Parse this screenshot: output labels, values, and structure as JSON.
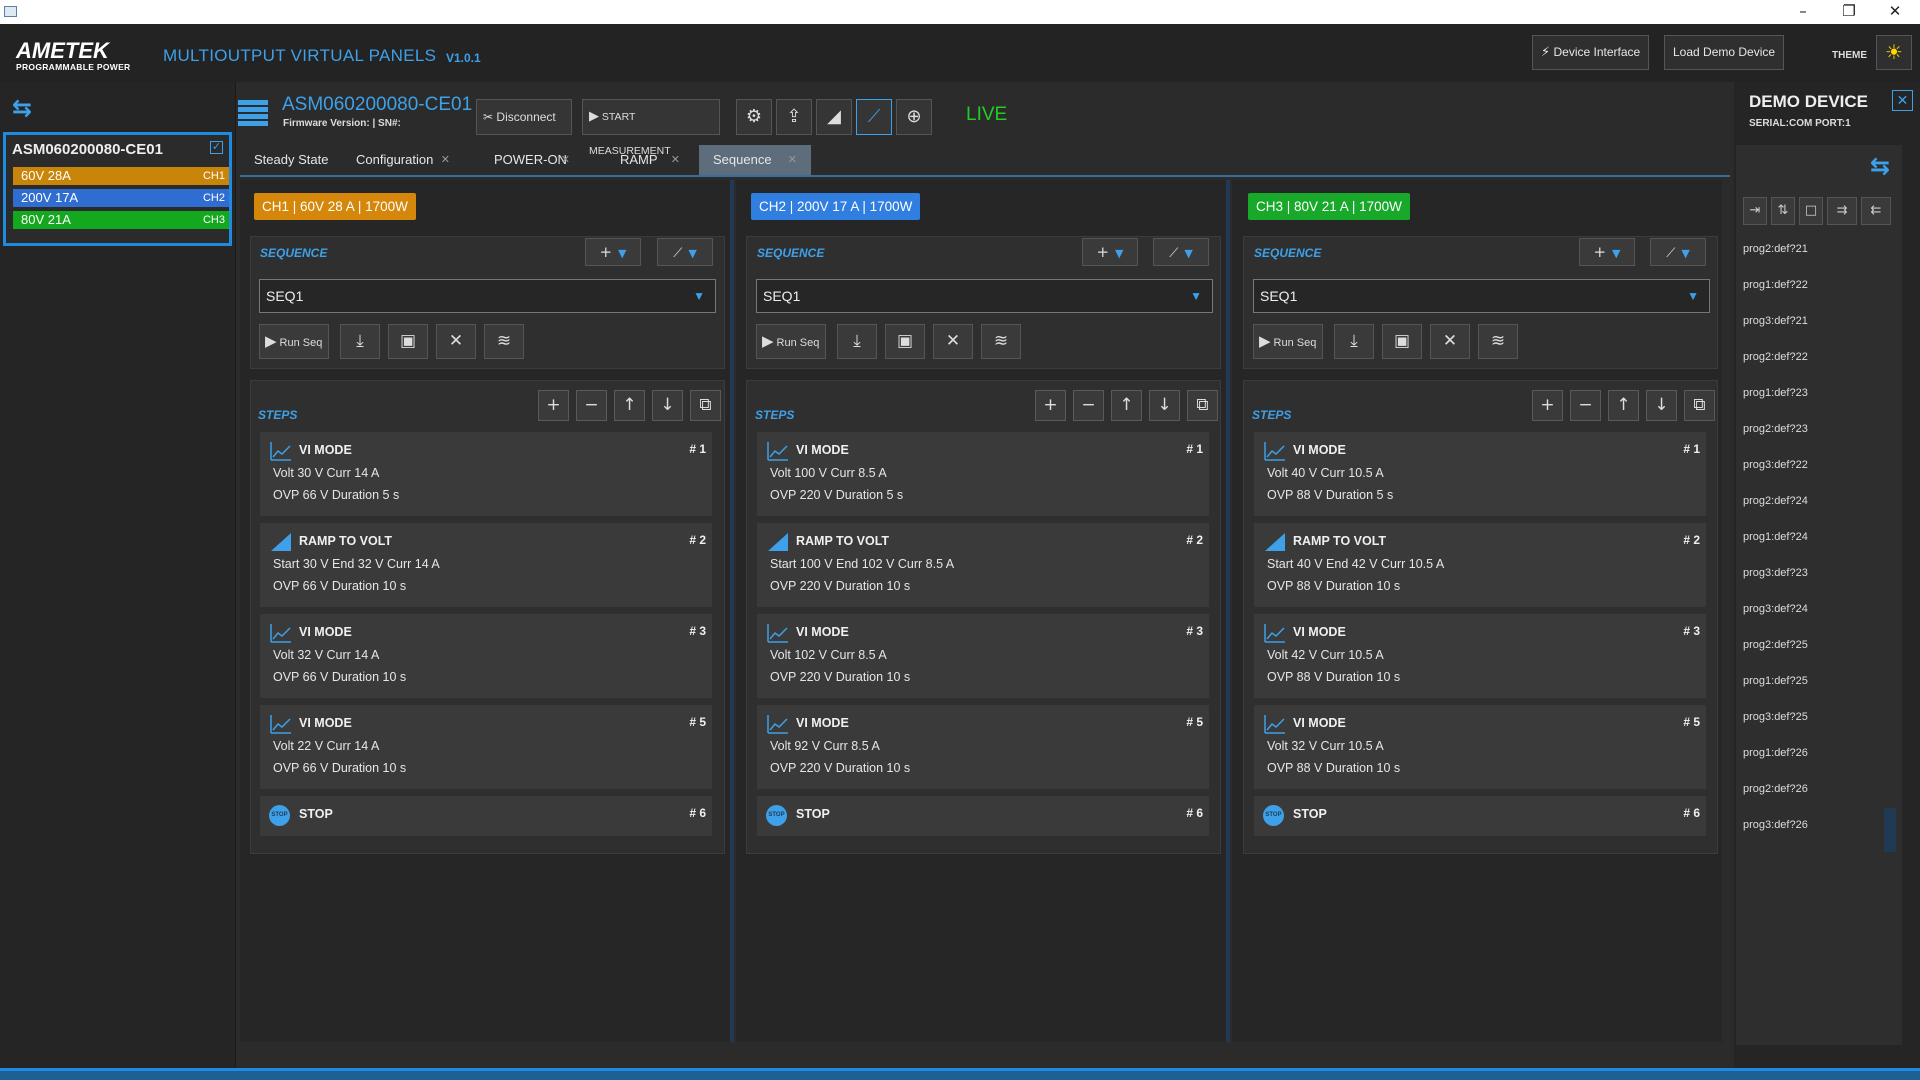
{
  "titlebar": {
    "minimize": "–",
    "restore": "❐",
    "close": "✕"
  },
  "header": {
    "logo_main": "AMETEK",
    "logo_sub": "PROGRAMMABLE POWER",
    "app_title": "MULTIOUTPUT VIRTUAL PANELS",
    "version": "V1.0.1",
    "device_interface": "Device Interface",
    "load_demo": "Load Demo Device",
    "theme_label": "THEME",
    "theme_icon": "sun-icon"
  },
  "sidebar": {
    "device_name": "ASM060200080-CE01",
    "channels": [
      {
        "label": "60V 28A",
        "tag": "CH1",
        "color": "#c8850a"
      },
      {
        "label": "200V 17A",
        "tag": "CH2",
        "color": "#2f6ed0"
      },
      {
        "label": "80V 21A",
        "tag": "CH3",
        "color": "#14a81e"
      }
    ]
  },
  "device": {
    "name": "ASM060200080-CE01",
    "firmware": "Firmware Version:  |  SN#:",
    "disconnect": "Disconnect",
    "start_measurement": "START MEASUREMENT",
    "status": "LIVE",
    "tool_icons": [
      "gear-icon",
      "export-icon",
      "ramp-icon",
      "chart-icon",
      "target-icon"
    ]
  },
  "tabs": [
    {
      "label": "Steady State",
      "closable": false
    },
    {
      "label": "Configuration",
      "closable": true
    },
    {
      "label": "POWER-ON",
      "closable": true
    },
    {
      "label": "RAMP",
      "closable": true
    },
    {
      "label": "Sequence",
      "closable": true,
      "active": true
    }
  ],
  "channels": [
    {
      "badge": "CH1 | 60V 28 A | 1700W",
      "color": "#d4870a",
      "sequence_label": "SEQUENCE",
      "selected_sequence": "SEQ1",
      "run_label": "Run Seq",
      "steps_label": "STEPS",
      "steps": [
        {
          "type": "VI MODE",
          "num": "# 1",
          "l1": "Volt 30 V   Curr 14 A",
          "l2": "OVP  66 V   Duration  5 s"
        },
        {
          "type": "RAMP TO VOLT",
          "num": "# 2",
          "l1": "Start 30 V  End 32 V  Curr 14 A",
          "l2": "OVP 66 V  Duration 10 s"
        },
        {
          "type": "VI MODE",
          "num": "# 3",
          "l1": "Volt 32 V   Curr 14 A",
          "l2": "OVP  66 V   Duration  10 s"
        },
        {
          "type": "VI MODE",
          "num": "# 5",
          "l1": "Volt 22 V   Curr 14 A",
          "l2": "OVP  66 V   Duration  10 s"
        },
        {
          "type": "STOP",
          "num": "# 6"
        }
      ]
    },
    {
      "badge": "CH2 | 200V 17 A | 1700W",
      "color": "#2f7ee0",
      "sequence_label": "SEQUENCE",
      "selected_sequence": "SEQ1",
      "run_label": "Run Seq",
      "steps_label": "STEPS",
      "steps": [
        {
          "type": "VI MODE",
          "num": "# 1",
          "l1": "Volt 100 V   Curr 8.5 A",
          "l2": "OVP  220 V   Duration  5 s"
        },
        {
          "type": "RAMP TO VOLT",
          "num": "# 2",
          "l1": "Start 100 V  End 102 V  Curr 8.5 A",
          "l2": "OVP 220 V  Duration 10 s"
        },
        {
          "type": "VI MODE",
          "num": "# 3",
          "l1": "Volt 102 V   Curr 8.5 A",
          "l2": "OVP  220 V   Duration  10 s"
        },
        {
          "type": "VI MODE",
          "num": "# 5",
          "l1": "Volt 92 V   Curr 8.5 A",
          "l2": "OVP  220 V   Duration  10 s"
        },
        {
          "type": "STOP",
          "num": "# 6"
        }
      ]
    },
    {
      "badge": "CH3 | 80V 21 A | 1700W",
      "color": "#18a82a",
      "sequence_label": "SEQUENCE",
      "selected_sequence": "SEQ1",
      "run_label": "Run Seq",
      "steps_label": "STEPS",
      "steps": [
        {
          "type": "VI MODE",
          "num": "# 1",
          "l1": "Volt 40 V   Curr 10.5 A",
          "l2": "OVP  88 V   Duration  5 s"
        },
        {
          "type": "RAMP TO VOLT",
          "num": "# 2",
          "l1": "Start 40 V  End 42 V  Curr 10.5 A",
          "l2": "OVP 88 V  Duration 10 s"
        },
        {
          "type": "VI MODE",
          "num": "# 3",
          "l1": "Volt 42 V   Curr 10.5 A",
          "l2": "OVP  88 V   Duration  10 s"
        },
        {
          "type": "VI MODE",
          "num": "# 5",
          "l1": "Volt 32 V   Curr 10.5 A",
          "l2": "OVP  88 V   Duration  10 s"
        },
        {
          "type": "STOP",
          "num": "# 6"
        }
      ]
    }
  ],
  "right_panel": {
    "title": "DEMO DEVICE",
    "subtitle": "SERIAL:COM PORT:1",
    "programs": [
      "prog2:def?21",
      "prog1:def?22",
      "prog3:def?21",
      "prog2:def?22",
      "prog1:def?23",
      "prog2:def?23",
      "prog3:def?22",
      "prog2:def?24",
      "prog1:def?24",
      "prog3:def?23",
      "prog3:def?24",
      "prog2:def?25",
      "prog1:def?25",
      "prog3:def?25",
      "prog1:def?26",
      "prog2:def?26",
      "prog3:def?26"
    ]
  },
  "step_labels": {
    "stop_icon_text": "STOP"
  }
}
